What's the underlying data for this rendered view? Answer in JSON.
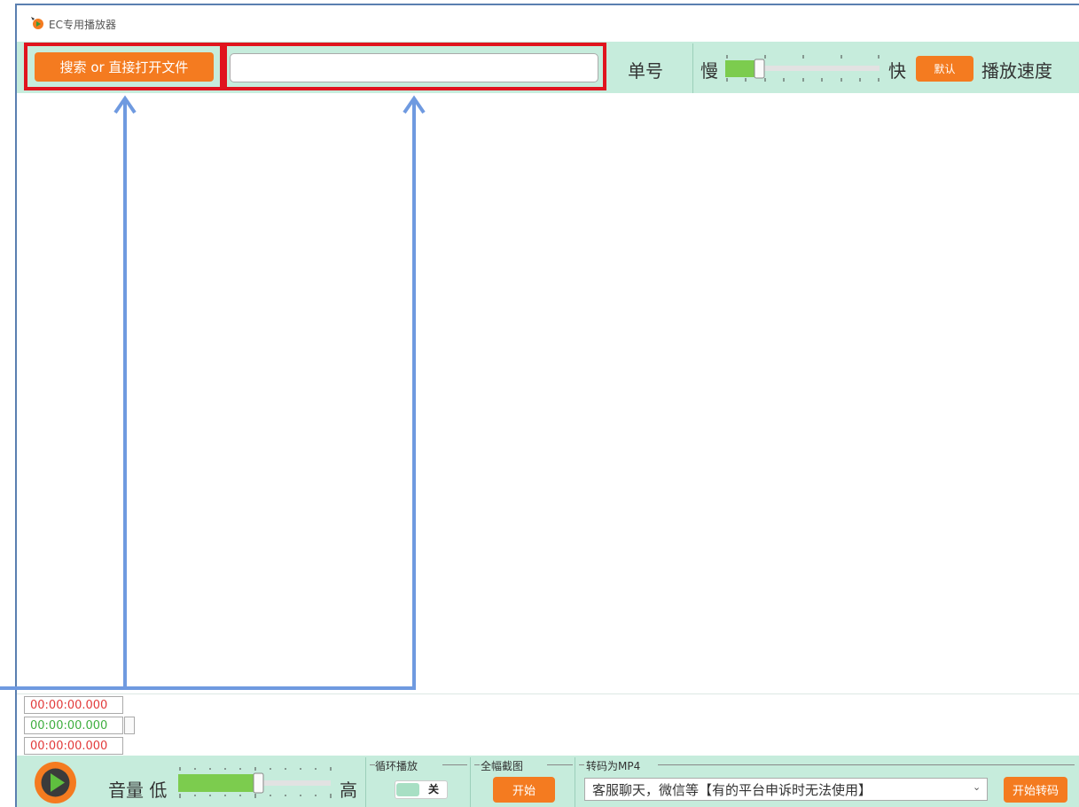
{
  "window": {
    "title": "EC专用播放器"
  },
  "toolbar": {
    "open_button": "搜索 or 直接打开文件",
    "search": {
      "value": "",
      "placeholder": ""
    },
    "order_label": "单号",
    "speed": {
      "slow_label": "慢",
      "fast_label": "快",
      "default_button": "默认",
      "label": "播放速度",
      "level": 0.2
    }
  },
  "timecodes": {
    "current": "00:00:00.000",
    "start": "00:00:00.000",
    "end": "00:00:00.000"
  },
  "bottom_bar": {
    "volume": {
      "label": "音量 低",
      "high_label": "高",
      "level": 0.53
    },
    "loop": {
      "title": "循环播放",
      "state": "关"
    },
    "snapshot": {
      "title": "全幅截图",
      "button": "开始"
    },
    "mp4": {
      "title": "转码为MP4",
      "selected_option": "客服聊天，微信等【有的平台申诉时无法使用】",
      "button": "开始转码"
    }
  },
  "colors": {
    "accent": "#f47b20",
    "toolbar_bg": "#c6ecdc",
    "highlight_red": "#e0141e",
    "annotation_blue": "#6f9ae0",
    "slider_fill": "#7ccc4e"
  },
  "icons": {
    "app": "app-icon",
    "play": "play-icon",
    "dropdown": "chevron-down-icon"
  }
}
